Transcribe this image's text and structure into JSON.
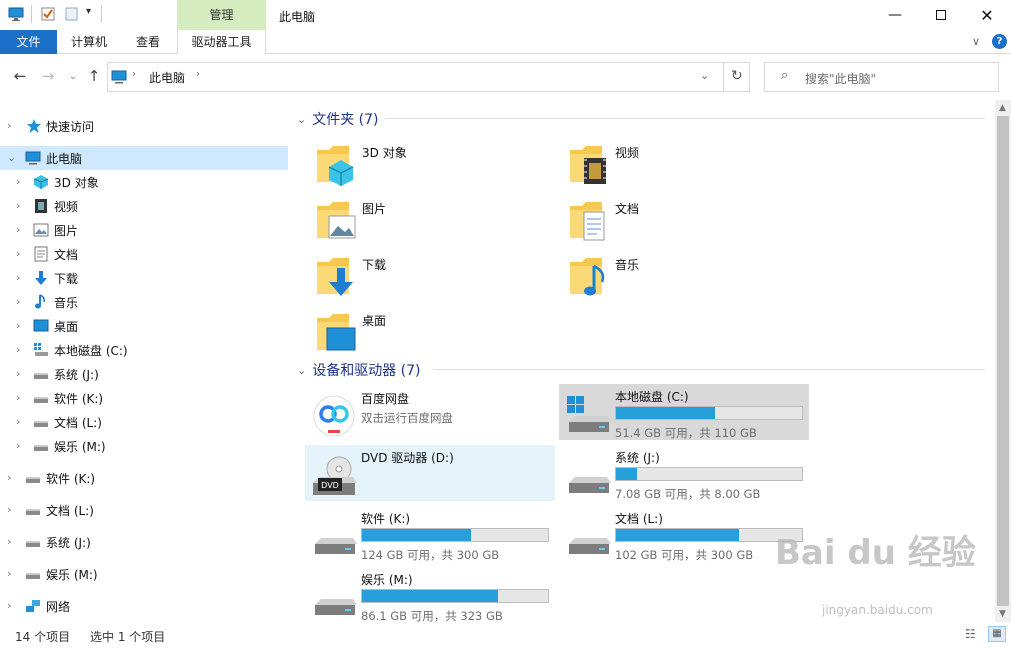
{
  "window": {
    "title": "此电脑",
    "ribbon_context_header": "管理"
  },
  "ribbon": {
    "tabs": [
      "文件",
      "计算机",
      "查看",
      "驱动器工具"
    ]
  },
  "address": {
    "crumbs": [
      "此电脑"
    ],
    "search_placeholder": "搜索\"此电脑\""
  },
  "sidebar": {
    "items": [
      {
        "label": "快速访问",
        "icon": "quick-access-star-icon"
      },
      {
        "label": "此电脑",
        "icon": "computer-icon"
      },
      {
        "label": "3D 对象",
        "icon": "3d-objects-icon"
      },
      {
        "label": "视频",
        "icon": "video-icon"
      },
      {
        "label": "图片",
        "icon": "pictures-icon"
      },
      {
        "label": "文档",
        "icon": "documents-icon"
      },
      {
        "label": "下载",
        "icon": "download-icon"
      },
      {
        "label": "音乐",
        "icon": "music-icon"
      },
      {
        "label": "桌面",
        "icon": "desktop-icon"
      },
      {
        "label": "本地磁盘 (C:)",
        "icon": "windows-drive-icon"
      },
      {
        "label": "系统 (J:)",
        "icon": "drive-icon"
      },
      {
        "label": "软件 (K:)",
        "icon": "drive-icon"
      },
      {
        "label": "文档 (L:)",
        "icon": "drive-icon"
      },
      {
        "label": "娱乐 (M:)",
        "icon": "drive-icon"
      },
      {
        "label": "软件 (K:)",
        "icon": "drive-icon"
      },
      {
        "label": "文档 (L:)",
        "icon": "drive-icon"
      },
      {
        "label": "系统 (J:)",
        "icon": "drive-icon"
      },
      {
        "label": "娱乐 (M:)",
        "icon": "drive-icon"
      },
      {
        "label": "网络",
        "icon": "network-icon"
      }
    ]
  },
  "folders_group": {
    "title": "文件夹 (7)",
    "items": [
      {
        "name": "3D 对象",
        "icon": "3d-folder-icon"
      },
      {
        "name": "视频",
        "icon": "video-folder-icon"
      },
      {
        "name": "图片",
        "icon": "pictures-folder-icon"
      },
      {
        "name": "文档",
        "icon": "documents-folder-icon"
      },
      {
        "name": "下载",
        "icon": "download-folder-icon"
      },
      {
        "name": "音乐",
        "icon": "music-folder-icon"
      },
      {
        "name": "桌面",
        "icon": "desktop-folder-icon"
      }
    ]
  },
  "drives_group": {
    "title": "设备和驱动器 (7)",
    "items": [
      {
        "name": "百度网盘",
        "sub": "双击运行百度网盘",
        "icon": "baidu-netdisk-icon"
      },
      {
        "name": "本地磁盘 (C:)",
        "sub": "51.4 GB 可用，共 110 GB",
        "used_fraction": 0.53,
        "icon": "windows-drive-icon"
      },
      {
        "name": "DVD 驱动器 (D:)",
        "icon": "dvd-drive-icon"
      },
      {
        "name": "系统 (J:)",
        "sub": "7.08 GB 可用，共 8.00 GB",
        "used_fraction": 0.115,
        "icon": "drive-icon"
      },
      {
        "name": "软件 (K:)",
        "sub": "124 GB 可用，共 300 GB",
        "used_fraction": 0.587,
        "icon": "drive-icon"
      },
      {
        "name": "文档 (L:)",
        "sub": "102 GB 可用，共 300 GB",
        "used_fraction": 0.66,
        "icon": "drive-icon"
      },
      {
        "name": "娱乐 (M:)",
        "sub": "86.1 GB 可用，共 323 GB",
        "used_fraction": 0.733,
        "icon": "drive-icon"
      }
    ]
  },
  "status": {
    "count": "14 个项目",
    "selected": "选中 1 个项目"
  },
  "watermark": {
    "brand": "Bai du 经验",
    "url": "jingyan.baidu.com"
  },
  "colors": {
    "accent": "#1a6fc7",
    "bar_fill": "#26a0da",
    "selection": "#cde8ff",
    "manage_tab": "#d4ecc0"
  }
}
